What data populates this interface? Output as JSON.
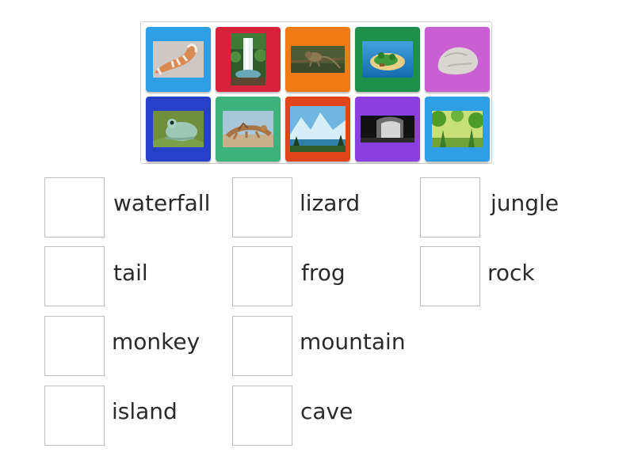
{
  "tiles": [
    {
      "icon": "tail-icon",
      "color": "#2e9fe6"
    },
    {
      "icon": "waterfall-icon",
      "color": "#d8213a"
    },
    {
      "icon": "monkey-icon",
      "color": "#f07a14"
    },
    {
      "icon": "island-icon",
      "color": "#1f8f4c"
    },
    {
      "icon": "rock-icon",
      "color": "#c95fd2"
    },
    {
      "icon": "frog-icon",
      "color": "#2640c9"
    },
    {
      "icon": "lizard-icon",
      "color": "#3cb37c"
    },
    {
      "icon": "mountain-icon",
      "color": "#e2441c"
    },
    {
      "icon": "cave-icon",
      "color": "#8a3fe0"
    },
    {
      "icon": "jungle-icon",
      "color": "#2e9fe6"
    }
  ],
  "targets": [
    {
      "label": "waterfall"
    },
    {
      "label": "lizard"
    },
    {
      "label": "jungle"
    },
    {
      "label": "tail"
    },
    {
      "label": "frog"
    },
    {
      "label": "rock"
    },
    {
      "label": "monkey"
    },
    {
      "label": "mountain"
    },
    {
      "label": "island"
    },
    {
      "label": "cave"
    }
  ]
}
